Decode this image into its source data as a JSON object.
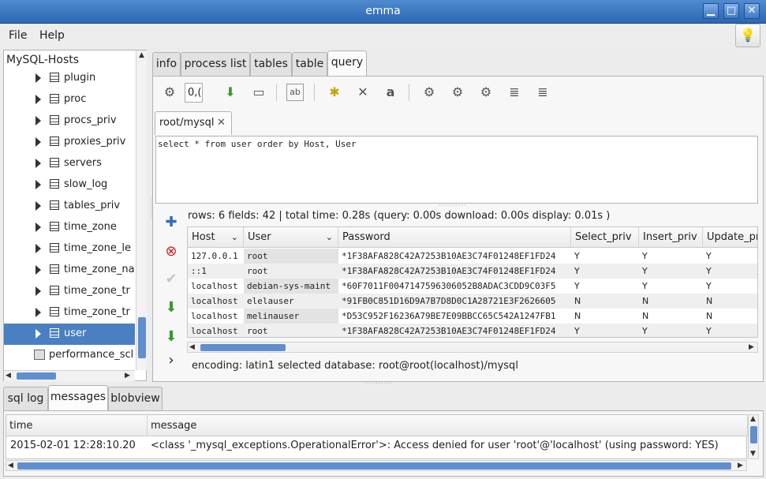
{
  "window": {
    "title": "emma"
  },
  "menu": {
    "file": "File",
    "help": "Help"
  },
  "tree": {
    "header": "MySQL-Hosts",
    "items": [
      {
        "label": "plugin"
      },
      {
        "label": "proc"
      },
      {
        "label": "procs_priv"
      },
      {
        "label": "proxies_priv"
      },
      {
        "label": "servers"
      },
      {
        "label": "slow_log"
      },
      {
        "label": "tables_priv"
      },
      {
        "label": "time_zone"
      },
      {
        "label": "time_zone_le"
      },
      {
        "label": "time_zone_na"
      },
      {
        "label": "time_zone_tr"
      },
      {
        "label": "time_zone_tr"
      },
      {
        "label": "user"
      }
    ],
    "extra_item": "performance_scl"
  },
  "tabs": [
    "info",
    "process list",
    "tables",
    "table",
    "query"
  ],
  "toolbar": {
    "spin_value": "0,("
  },
  "query": {
    "tab_label": "root/mysql",
    "sql": "select * from user order by Host, User",
    "result_info": "rows: 6 fields: 42 | total time: 0.28s (query: 0.00s download: 0.00s display: 0.01s )",
    "encoding_info": "encoding: latin1   selected database: root@root(localhost)/mysql"
  },
  "grid": {
    "columns": [
      "Host",
      "User",
      "Password",
      "Select_priv",
      "Insert_priv",
      "Update_pri"
    ],
    "rows": [
      [
        "127.0.0.1",
        "root",
        "*1F38AFA828C42A7253B10AE3C74F01248EF1FD24",
        "Y",
        "Y",
        "Y"
      ],
      [
        "::1",
        "root",
        "*1F38AFA828C42A7253B10AE3C74F01248EF1FD24",
        "Y",
        "Y",
        "Y"
      ],
      [
        "localhost",
        "debian-sys-maint",
        "*60F7011F0047147596306052B8ADAC3CDD9C03F5",
        "Y",
        "Y",
        "Y"
      ],
      [
        "localhost",
        "elelauser",
        "*91FB0C851D16D9A7B7D8D0C1A28721E3F2626605",
        "N",
        "N",
        "N"
      ],
      [
        "localhost",
        "melinauser",
        "*D53C952F16236A79BE7E09BBCC65C542A1247FB1",
        "N",
        "N",
        "N"
      ],
      [
        "localhost",
        "root",
        "*1F38AFA828C42A7253B10AE3C74F01248EF1FD24",
        "Y",
        "Y",
        "Y"
      ]
    ]
  },
  "bottom_tabs": [
    "sql log",
    "messages",
    "blobview"
  ],
  "messages": {
    "columns": [
      "time",
      "message"
    ],
    "rows": [
      [
        "2015-02-01 12:28:10.20",
        "<class '_mysql_exceptions.OperationalError'>: Access denied for user 'root'@'localhost' (using password: YES)"
      ]
    ]
  },
  "icons": {
    "minimize": "▁",
    "maximize": "□",
    "close": "✕",
    "bulb": "💡",
    "add": "✚",
    "delete": "⊗",
    "apply": "✔",
    "save": "⬇",
    "next": "›"
  },
  "colors": {
    "titlebar": "#2c66b3",
    "selection": "#4a7fc1",
    "scroll_thumb": "#5f8fcf"
  }
}
